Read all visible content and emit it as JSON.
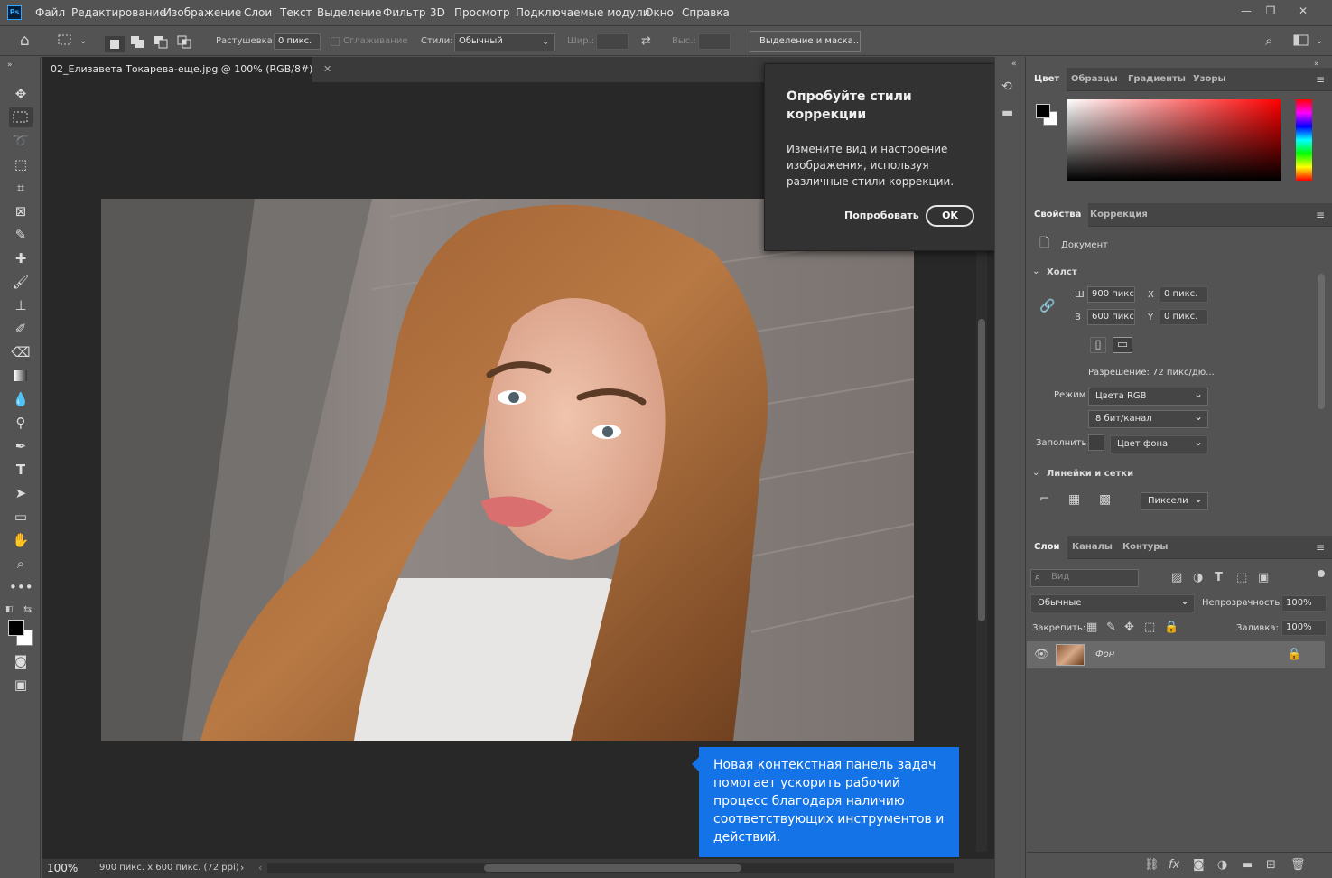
{
  "app": {
    "logo": "Ps"
  },
  "menu": [
    "Файл",
    "Редактирование",
    "Изображение",
    "Слои",
    "Текст",
    "Выделение",
    "Фильтр",
    "3D",
    "Просмотр",
    "Подключаемые модули",
    "Окно",
    "Справка"
  ],
  "window_controls": {
    "minimize": "—",
    "restore": "❐",
    "close": "✕"
  },
  "options": {
    "feather_label": "Растушевка:",
    "feather_value": "0 пикс.",
    "antialias_label": "Сглаживание",
    "style_label": "Стили:",
    "style_value": "Обычный",
    "width_label": "Шир.:",
    "height_label": "Выс.:",
    "select_mask_button": "Выделение и маска..."
  },
  "document": {
    "tab_title": "02_Елизавета Токарева-еще.jpg @ 100% (RGB/8#)",
    "zoom": "100%",
    "status": "900 пикс. x 600 пикс. (72 ppi)"
  },
  "popup": {
    "title": "Опробуйте стили коррекции",
    "body": "Измените вид и настроение изображения, используя различные стили коррекции.",
    "try_button": "Попробовать",
    "ok_button": "OK"
  },
  "tip": "Новая контекстная панель задач помогает ускорить рабочий процесс благодаря наличию соответствующих инструментов и действий.",
  "color_panel": {
    "tabs": [
      "Цвет",
      "Образцы",
      "Градиенты",
      "Узоры"
    ]
  },
  "properties_panel": {
    "tabs": [
      "Свойства",
      "Коррекция"
    ],
    "document_label": "Документ",
    "canvas_section": "Холст",
    "w_label": "Ш",
    "w_value": "900 пикс.",
    "h_label": "В",
    "h_value": "600 пикс.",
    "x_label": "X",
    "x_value": "0 пикс.",
    "y_label": "Y",
    "y_value": "0 пикс.",
    "resolution": "Разрешение: 72 пикс/дю...",
    "mode_label": "Режим",
    "mode_value": "Цвета RGB",
    "depth_value": "8 бит/канал",
    "fill_label": "Заполнить",
    "fill_value": "Цвет фона",
    "rulers_section": "Линейки и сетки",
    "units_value": "Пиксели"
  },
  "layers_panel": {
    "tabs": [
      "Слои",
      "Каналы",
      "Контуры"
    ],
    "search_placeholder": "Вид",
    "blend_mode": "Обычные",
    "opacity_label": "Непрозрачность:",
    "opacity_value": "100%",
    "lock_label": "Закрепить:",
    "fill_label": "Заливка:",
    "fill_value": "100%",
    "layer_name": "Фон"
  }
}
